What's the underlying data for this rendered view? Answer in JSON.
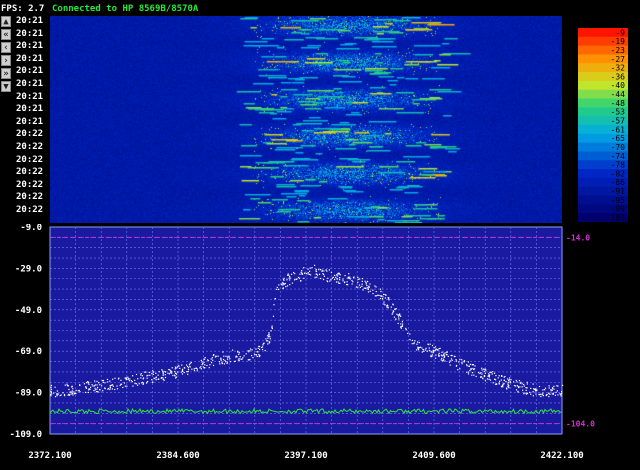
{
  "header": {
    "fps": "FPS: 2.7",
    "status": "Connected to HP 8569B/8570A"
  },
  "nav_buttons": [
    {
      "label": "▲",
      "name": "scroll-up-button"
    },
    {
      "label": "«",
      "name": "fast-rewind-button"
    },
    {
      "label": "‹",
      "name": "step-back-button"
    },
    {
      "label": "›",
      "name": "step-forward-button"
    },
    {
      "label": "»",
      "name": "fast-forward-button"
    },
    {
      "label": "▼",
      "name": "scroll-down-button"
    }
  ],
  "timestamps": [
    "20:21",
    "20:21",
    "20:21",
    "20:21",
    "20:21",
    "20:21",
    "20:21",
    "20:21",
    "20:21",
    "20:22",
    "20:22",
    "20:22",
    "20:22",
    "20:22",
    "20:22",
    "20:22"
  ],
  "legend_levels": [
    -9,
    -19,
    -23,
    -27,
    -32,
    -36,
    -40,
    -44,
    -48,
    -53,
    -57,
    -61,
    -65,
    -70,
    -74,
    -78,
    -82,
    -86,
    -91,
    -95,
    -99,
    -103
  ],
  "colors": {
    "spectrum_bg": "#1a1aa0",
    "grid": "#6a7cf0",
    "marker": "#d030d0",
    "noise": "#28e83a",
    "trace": "#ffffff"
  },
  "chart_data": {
    "type": "line",
    "xlim": [
      2372.1,
      2422.1
    ],
    "ylim": [
      -109.0,
      -9.0
    ],
    "x_ticks": [
      "2372.100",
      "2384.600",
      "2397.100",
      "2409.600",
      "2422.100"
    ],
    "y_ticks": [
      "-9.0",
      "-29.0",
      "-49.0",
      "-69.0",
      "-89.0",
      "-109.0"
    ],
    "ref_lines": [
      {
        "value": -14.0,
        "label": "-14.0"
      },
      {
        "value": -104.0,
        "label": "-104.0"
      }
    ],
    "series": [
      {
        "x": [
          2372.1,
          2374,
          2376,
          2378,
          2380,
          2382,
          2384,
          2386,
          2388,
          2389,
          2390,
          2391,
          2392,
          2393,
          2393.7,
          2394,
          2395,
          2396,
          2397,
          2398,
          2399,
          2400,
          2401,
          2402,
          2403,
          2404,
          2405,
          2406,
          2407,
          2408,
          2410,
          2412,
          2414,
          2416,
          2418,
          2420,
          2422.1
        ],
        "y": [
          -88,
          -87,
          -86,
          -85,
          -83,
          -81,
          -79,
          -77,
          -73,
          -72,
          -71,
          -70,
          -70,
          -67,
          -60,
          -42,
          -35,
          -33,
          -31,
          -30,
          -32,
          -33,
          -34,
          -35,
          -37,
          -40,
          -45,
          -52,
          -60,
          -66,
          -70,
          -75,
          -79,
          -83,
          -86,
          -88,
          -88
        ]
      },
      {
        "x": [
          2372.1,
          2422.1
        ],
        "y": [
          -98,
          -98
        ]
      }
    ]
  }
}
